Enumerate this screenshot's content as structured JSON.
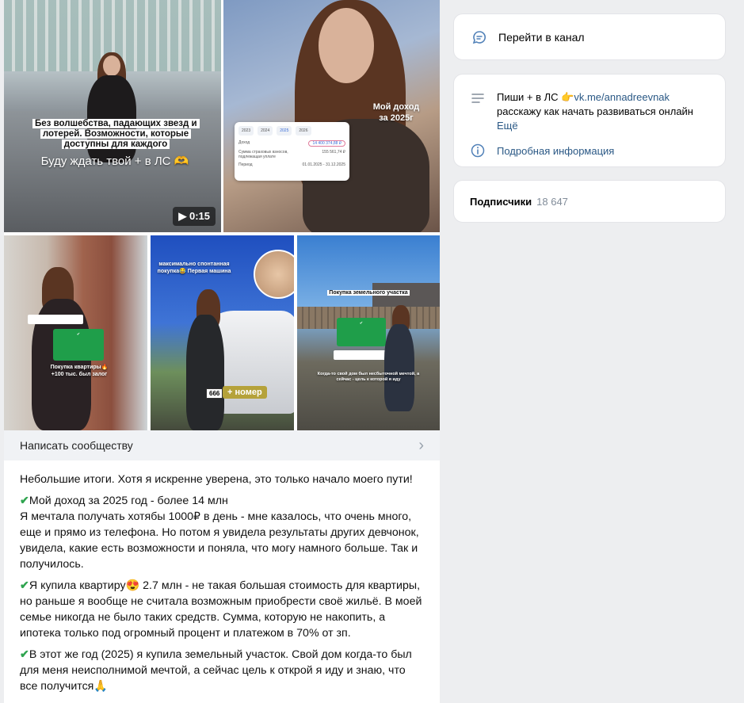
{
  "media": {
    "video_caption_box": "Без волшебства, падающих звезд и лотерей. Возможности, которые доступны для каждого",
    "video_caption_line": "Буду ждать твой + в ЛС 🫶",
    "video_duration": "0:15",
    "income_title": "Мой доход за 2025г",
    "income_years": [
      "2023",
      "2024",
      "2025",
      "2026"
    ],
    "income_rows": [
      {
        "label": "Доход",
        "value": "14 400 374,88 ₽"
      },
      {
        "label": "Сумма страховых взносов, подлежащая уплате",
        "value": "155 561,74 ₽"
      },
      {
        "label": "Период",
        "value": "01.01.2025 - 31.12.2025"
      }
    ],
    "tile3_caption": "Покупка квартиры🔥 +100 тыс. был залог",
    "tile4_caption": "максимально спонтанная покупка😂 Первая машина",
    "tile4_plate": "666",
    "tile4_tag": "+ номер",
    "tile5_caption": "Покупка земельного участка",
    "tile5_bottom": "Когда-то свой дом был несбыточной мечтой, а сейчас - цель к которой я иду"
  },
  "write_label": "Написать сообществу",
  "post": {
    "paragraphs": [
      "Небольшие итоги. Хотя я искренне уверена, это только начало моего пути!",
      "Мой доход за 2025 год - более 14 млн",
      "Я мечтала получать хотябы 1000₽ в день - мне казалось, что очень много, еще и прямо из телефона. Но потом я увидела результаты других девчонок, увидела, какие есть возможности и поняла, что могу намного больше. Так и получилось.",
      "Я купила квартиру😍 2.7 млн - не такая большая стоимость для квартиры, но раньше я вообще не считала возможным приобрести своё жильё. В моей семье никогда не было таких средств. Сумма, которую не накопить, а ипотека только под огромный процент и платежом в 70% от зп.",
      "В этот же год (2025) я купила земельный участок. Свой дом когда-то был для меня неисполнимой мечтой, а сейчас цель к открой я иду и знаю, что все получится🙏"
    ],
    "check_mark": "✔"
  },
  "sidebar": {
    "go_channel": "Перейти в канал",
    "desc_prefix": "Пиши + в ЛС 👉",
    "desc_link": "vk.me/annadreevnak",
    "desc_line2": "расскажу как начать развиваться онлайн",
    "more": "Ещё",
    "details": "Подробная информация",
    "subs_label": "Подписчики",
    "subs_count": "18 647"
  },
  "colors": {
    "accent": "#2a5885",
    "check": "#2fa44f",
    "background": "#edeef0"
  }
}
